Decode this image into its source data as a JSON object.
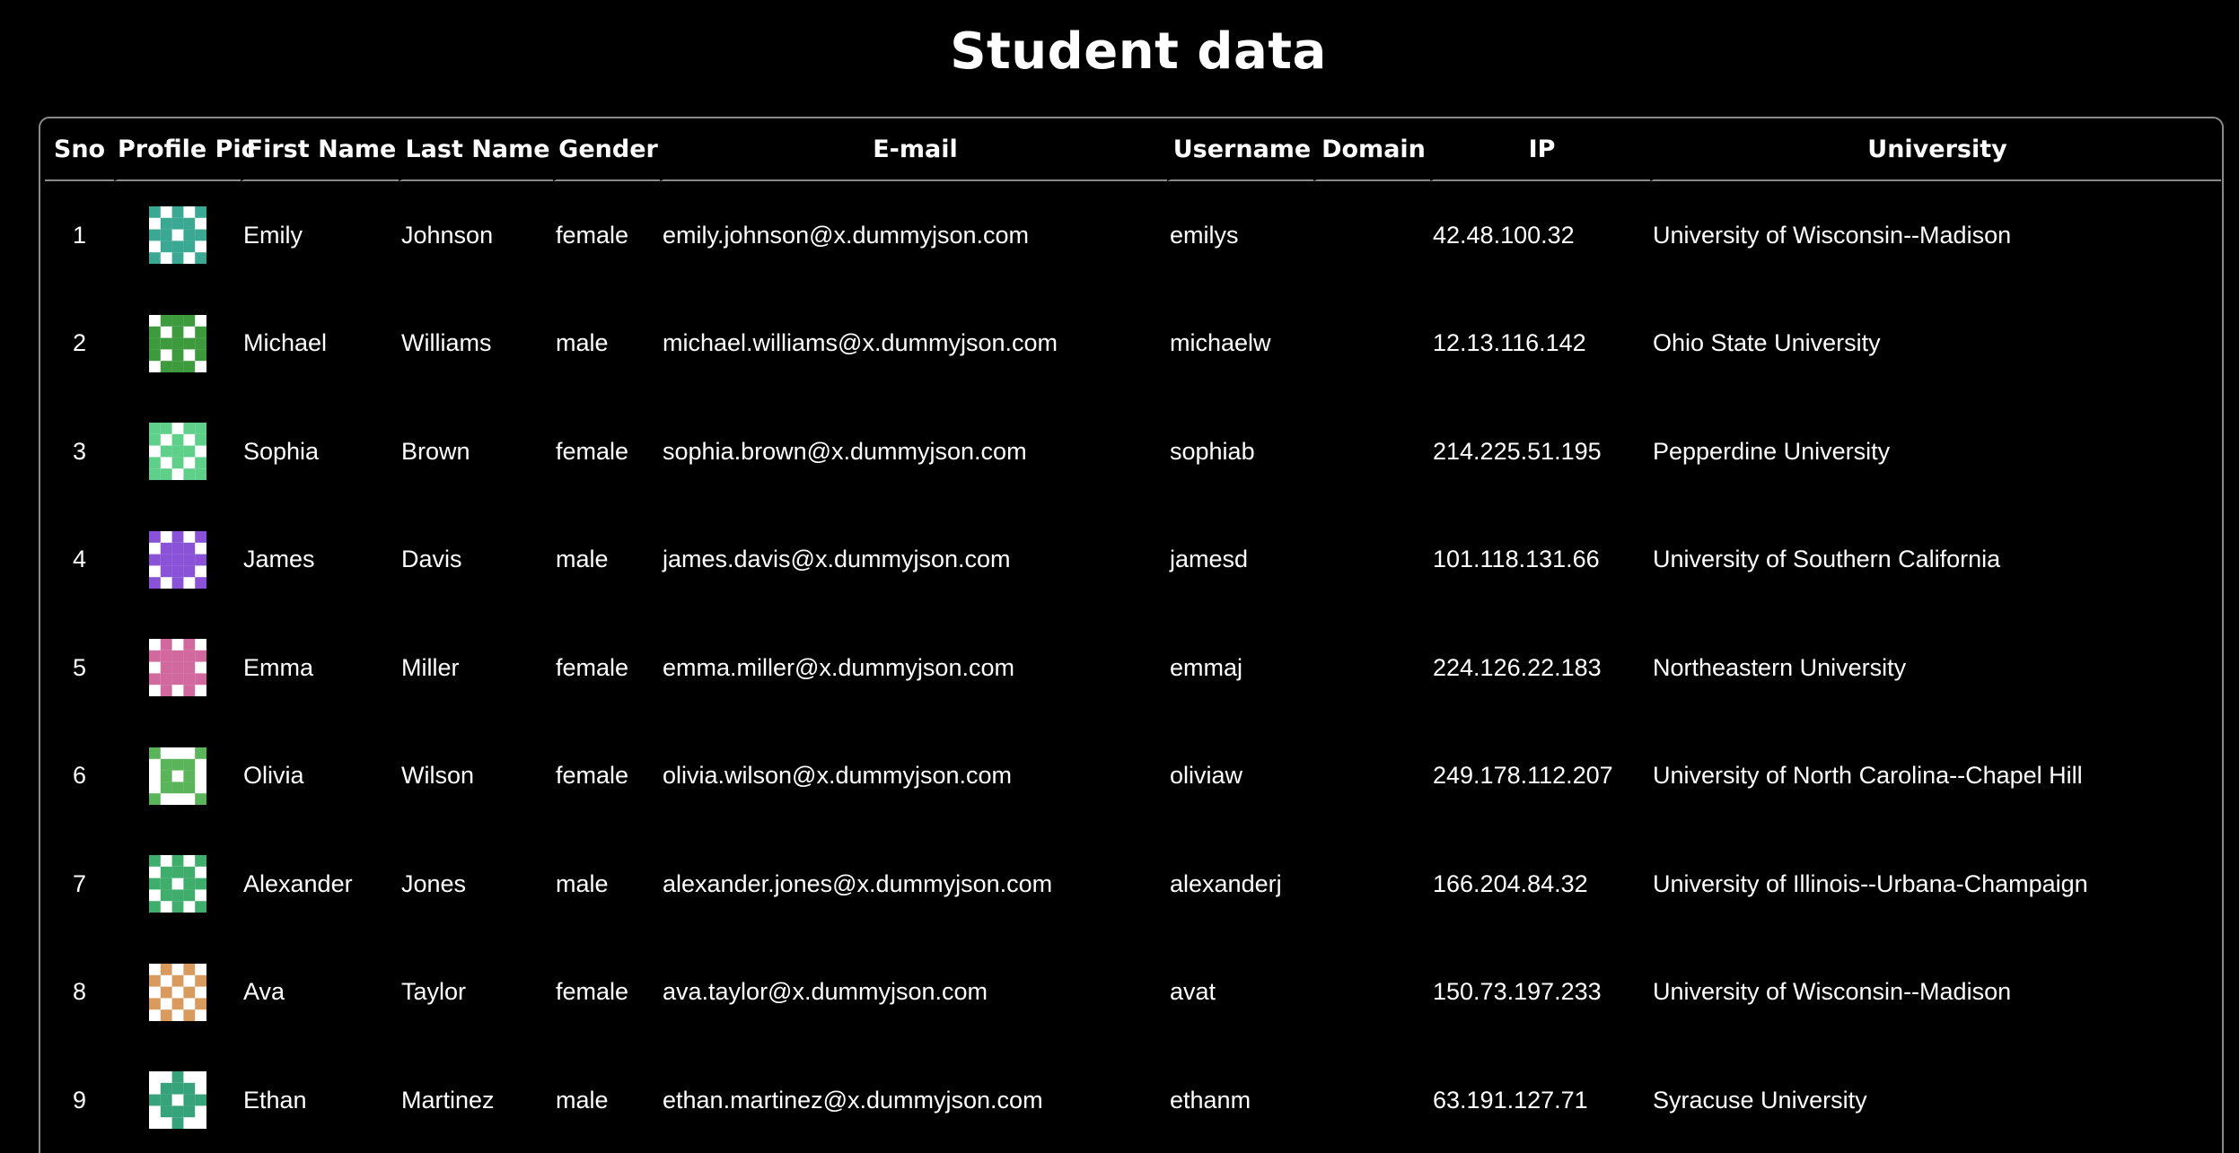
{
  "page": {
    "title": "Student data"
  },
  "table": {
    "headers": [
      "Sno",
      "Profile Pic",
      "First Name",
      "Last Name",
      "Gender",
      "E-mail",
      "Username",
      "Domain",
      "IP",
      "University"
    ],
    "rows": [
      {
        "sno": "1",
        "avatar_icon": "identicon-avatar",
        "avatar_color": "#3aa892",
        "first": "Emily",
        "last": "Johnson",
        "gender": "female",
        "email": "emily.johnson@x.dummyjson.com",
        "username": "emilys",
        "domain": "",
        "ip": "42.48.100.32",
        "university": "University of Wisconsin--Madison"
      },
      {
        "sno": "2",
        "avatar_icon": "identicon-avatar",
        "avatar_color": "#3d9a3d",
        "first": "Michael",
        "last": "Williams",
        "gender": "male",
        "email": "michael.williams@x.dummyjson.com",
        "username": "michaelw",
        "domain": "",
        "ip": "12.13.116.142",
        "university": "Ohio State University"
      },
      {
        "sno": "3",
        "avatar_icon": "identicon-avatar",
        "avatar_color": "#5fd08a",
        "first": "Sophia",
        "last": "Brown",
        "gender": "female",
        "email": "sophia.brown@x.dummyjson.com",
        "username": "sophiab",
        "domain": "",
        "ip": "214.225.51.195",
        "university": "Pepperdine University"
      },
      {
        "sno": "4",
        "avatar_icon": "identicon-avatar",
        "avatar_color": "#8a52d6",
        "first": "James",
        "last": "Davis",
        "gender": "male",
        "email": "james.davis@x.dummyjson.com",
        "username": "jamesd",
        "domain": "",
        "ip": "101.118.131.66",
        "university": "University of Southern California"
      },
      {
        "sno": "5",
        "avatar_icon": "identicon-avatar",
        "avatar_color": "#d1689e",
        "first": "Emma",
        "last": "Miller",
        "gender": "female",
        "email": "emma.miller@x.dummyjson.com",
        "username": "emmaj",
        "domain": "",
        "ip": "224.126.22.183",
        "university": "Northeastern University"
      },
      {
        "sno": "6",
        "avatar_icon": "identicon-avatar",
        "avatar_color": "#5ab45a",
        "first": "Olivia",
        "last": "Wilson",
        "gender": "female",
        "email": "olivia.wilson@x.dummyjson.com",
        "username": "oliviaw",
        "domain": "",
        "ip": "249.178.112.207",
        "university": "University of North Carolina--Chapel Hill"
      },
      {
        "sno": "7",
        "avatar_icon": "identicon-avatar",
        "avatar_color": "#3fae6c",
        "first": "Alexander",
        "last": "Jones",
        "gender": "male",
        "email": "alexander.jones@x.dummyjson.com",
        "username": "alexanderj",
        "domain": "",
        "ip": "166.204.84.32",
        "university": "University of Illinois--Urbana-Champaign"
      },
      {
        "sno": "8",
        "avatar_icon": "identicon-avatar",
        "avatar_color": "#d99a5e",
        "first": "Ava",
        "last": "Taylor",
        "gender": "female",
        "email": "ava.taylor@x.dummyjson.com",
        "username": "avat",
        "domain": "",
        "ip": "150.73.197.233",
        "university": "University of Wisconsin--Madison"
      },
      {
        "sno": "9",
        "avatar_icon": "identicon-avatar",
        "avatar_color": "#37a37a",
        "first": "Ethan",
        "last": "Martinez",
        "gender": "male",
        "email": "ethan.martinez@x.dummyjson.com",
        "username": "ethanm",
        "domain": "",
        "ip": "63.191.127.71",
        "university": "Syracuse University"
      }
    ]
  }
}
